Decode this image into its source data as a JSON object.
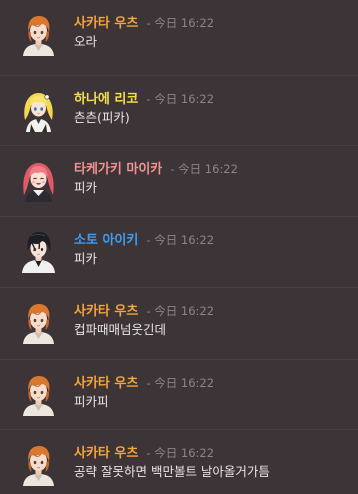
{
  "messages": [
    {
      "author": "사카타 우츠",
      "author_color": "#f5a53a",
      "timestamp": "- 今日 16:22",
      "text": "오라",
      "avatar_icon": "orange-haired-boy-avatar"
    },
    {
      "author": "하나에 리코",
      "author_color": "#f3e04c",
      "timestamp": "- 今日 16:22",
      "text": "츤츤(피카)",
      "avatar_icon": "blonde-girl-avatar"
    },
    {
      "author": "타케가키 마이카",
      "author_color": "#f19393",
      "timestamp": "- 今日 16:22",
      "text": "피카",
      "avatar_icon": "pink-haired-girl-avatar"
    },
    {
      "author": "소토 아이키",
      "author_color": "#3f9df0",
      "timestamp": "- 今日 16:22",
      "text": "피카",
      "avatar_icon": "black-haired-boy-avatar"
    },
    {
      "author": "사카타 우츠",
      "author_color": "#f5a53a",
      "timestamp": "- 今日 16:22",
      "text": "컵파때매넘웃긴데",
      "avatar_icon": "orange-haired-boy-avatar"
    },
    {
      "author": "사카타 우츠",
      "author_color": "#f5a53a",
      "timestamp": "- 今日 16:22",
      "text": "피카피",
      "avatar_icon": "orange-haired-boy-avatar"
    },
    {
      "author": "사카타 우츠",
      "author_color": "#f5a53a",
      "timestamp": "- 今日 16:22",
      "text": "공략 잘못하면 백만볼트 날아올거가틈",
      "avatar_icon": "orange-haired-boy-avatar"
    }
  ]
}
